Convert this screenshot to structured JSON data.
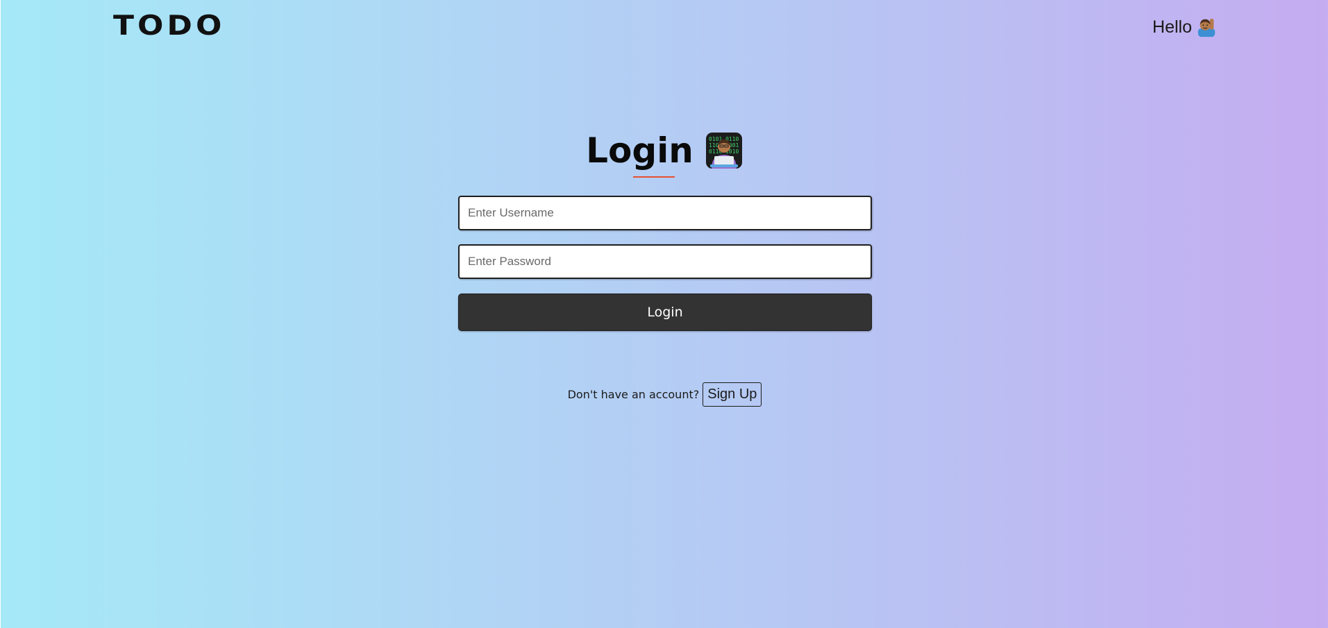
{
  "header": {
    "logo": "TODO",
    "greeting": "Hello",
    "greeting_icon": "raising-hand-emoji"
  },
  "login": {
    "title": "Login",
    "title_icon": "technologist-emoji",
    "accent_color": "#e8502f",
    "username_placeholder": "Enter Username",
    "password_placeholder": "Enter Password",
    "submit_label": "Login"
  },
  "signup": {
    "prompt": "Don't have an account?",
    "button_label": "Sign Up"
  }
}
